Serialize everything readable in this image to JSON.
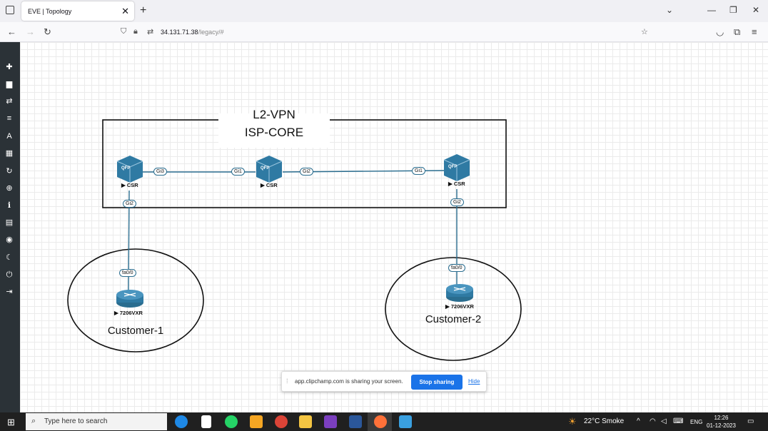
{
  "browser": {
    "tab_title": "EVE | Topology",
    "tab_close": "✕",
    "new_tab": "+",
    "url_host": "34.131.71.38",
    "url_path": "/legacy/#",
    "win_min": "—",
    "win_restore": "❐",
    "win_close": "✕",
    "tabs_dropdown": "⌄"
  },
  "topology": {
    "title": "L2-VPN",
    "core_label": "ISP-CORE",
    "customer1_label": "Customer-1",
    "customer2_label": "Customer-2",
    "routers": [
      {
        "label": "▶ CSR",
        "model": "QFP"
      },
      {
        "label": "▶ CSR",
        "model": "QFP"
      },
      {
        "label": "▶ CSR",
        "model": "QFP"
      },
      {
        "label": "▶ 7206VXR"
      },
      {
        "label": "▶ 7206VXR"
      }
    ],
    "ports": [
      "Gi3",
      "Gi1",
      "Gi2",
      "Gi1",
      "Gi2",
      "Gi2",
      "fa0/0",
      "fa0/0"
    ]
  },
  "share_bar": {
    "message": "app.clipchamp.com is sharing your screen.",
    "stop_label": "Stop sharing",
    "hide_label": "Hide"
  },
  "taskbar": {
    "search_placeholder": "Type here to search",
    "weather": "22°C Smoke",
    "language": "ENG",
    "time": "12:26",
    "date": "01-12-2023"
  },
  "colors": {
    "sidebar": "#2b3237",
    "link": "#2a6d8f",
    "router": "#2f7aa3",
    "share_button": "#1a73e8"
  }
}
